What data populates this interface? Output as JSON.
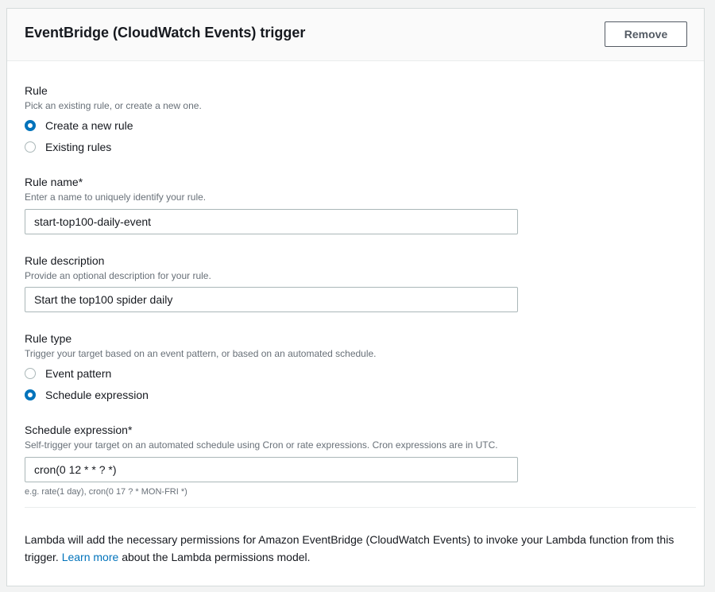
{
  "header": {
    "title": "EventBridge (CloudWatch Events) trigger",
    "remove_label": "Remove"
  },
  "rule": {
    "label": "Rule",
    "description": "Pick an existing rule, or create a new one.",
    "options": [
      {
        "label": "Create a new rule",
        "selected": true
      },
      {
        "label": "Existing rules",
        "selected": false
      }
    ]
  },
  "rule_name": {
    "label": "Rule name*",
    "description": "Enter a name to uniquely identify your rule.",
    "value": "start-top100-daily-event"
  },
  "rule_description": {
    "label": "Rule description",
    "description": "Provide an optional description for your rule.",
    "value": "Start the top100 spider daily"
  },
  "rule_type": {
    "label": "Rule type",
    "description": "Trigger your target based on an event pattern, or based on an automated schedule.",
    "options": [
      {
        "label": "Event pattern",
        "selected": false
      },
      {
        "label": "Schedule expression",
        "selected": true
      }
    ]
  },
  "schedule_expression": {
    "label": "Schedule expression*",
    "description": "Self-trigger your target on an automated schedule using Cron or rate expressions. Cron expressions are in UTC.",
    "value": "cron(0 12 * * ? *)",
    "hint": "e.g. rate(1 day), cron(0 17 ? * MON-FRI *)"
  },
  "footer": {
    "text_before": "Lambda will add the necessary permissions for Amazon EventBridge (CloudWatch Events) to invoke your Lambda function from this trigger.",
    "link": "Learn more",
    "text_after": "about the Lambda permissions model."
  },
  "colors": {
    "accent": "#0073bb",
    "text": "#16191f",
    "muted": "#687078"
  }
}
